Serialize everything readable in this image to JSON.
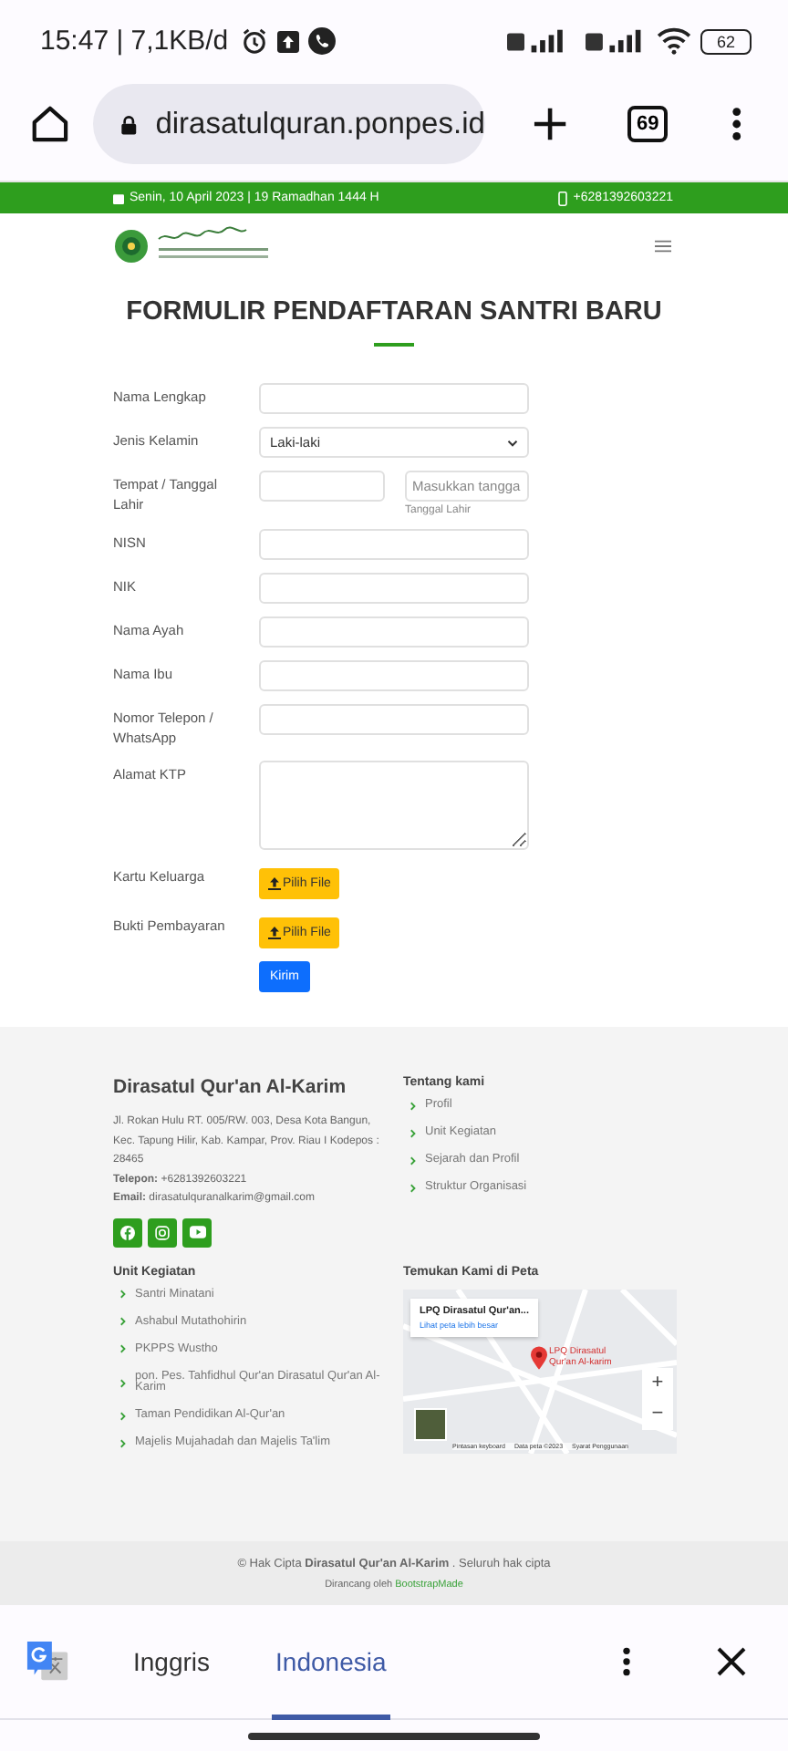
{
  "status_bar": {
    "time": "15:47 | 7,1KB/d",
    "battery": "62"
  },
  "browser": {
    "url": "dirasatulquran.ponpes.id",
    "tab_count": "69"
  },
  "top_bar": {
    "date": "Senin, 10 April 2023 | 19 Ramadhan 1444 H",
    "phone": "+6281392603221"
  },
  "form": {
    "title": "FORMULIR PENDAFTARAN SANTRI BARU",
    "fields": [
      {
        "kind": "text",
        "label": "Nama Lengkap"
      },
      {
        "kind": "select",
        "label": "Jenis Kelamin",
        "value": "Laki-laki"
      },
      {
        "kind": "date-pair",
        "label": "Tempat / Tanggal Lahir",
        "placeholder": "Masukkan tangga",
        "hint": "Tanggal Lahir"
      },
      {
        "kind": "text",
        "label": "NISN"
      },
      {
        "kind": "text",
        "label": "NIK"
      },
      {
        "kind": "text",
        "label": "Nama Ayah"
      },
      {
        "kind": "text",
        "label": "Nama Ibu"
      },
      {
        "kind": "text",
        "label": "Nomor Telepon / WhatsApp"
      },
      {
        "kind": "textarea",
        "label": "Alamat KTP"
      },
      {
        "kind": "file",
        "label": "Kartu Keluarga",
        "button": "Pilih File"
      },
      {
        "kind": "file",
        "label": "Bukti Pembayaran",
        "button": "Pilih File"
      }
    ],
    "submit": "Kirim"
  },
  "footer": {
    "name": "Dirasatul Qur'an Al-Karim",
    "address": "Jl. Rokan Hulu RT. 005/RW. 003, Desa Kota Bangun, Kec. Tapung Hilir, Kab. Kampar, Prov. Riau I Kodepos : 28465",
    "phone": "**Telepon:** +6281392603221",
    "email": "**Email:** dirasatulquranalkarim@gmail.com",
    "social": [
      {
        "kind": "facebook"
      },
      {
        "kind": "instagram"
      },
      {
        "kind": "youtube"
      }
    ],
    "about": {
      "title": "Tentang kami",
      "links": [
        "Profil",
        "Unit Kegiatan",
        "Sejarah dan Profil",
        "Struktur Organisasi"
      ]
    },
    "units": {
      "title": "Unit Kegiatan",
      "links": [
        "Santri Minatani",
        "Ashabul Mutathohirin",
        "PKPPS Wustho",
        "pon. Pes. Tahfidhul Qur'an Dirasatul Qur'an Al-Karim",
        "Taman Pendidikan Al-Qur'an",
        "Majelis Mujahadah dan Majelis Ta'lim"
      ]
    },
    "map": {
      "title": "Temukan Kami di Peta",
      "card_title": "LPQ Dirasatul Qur'an...",
      "card_link": "Lihat peta lebih besar",
      "marker_label": "LPQ Dirasatul Qur'an Al-karim",
      "zoom_in": "+",
      "zoom_out": "−",
      "attribution": [
        "Pintasan keyboard",
        "Data peta ©2023",
        "Syarat Penggunaan"
      ]
    }
  },
  "copyright": {
    "text": "© Hak Cipta **Dirasatul Qur'an Al-Karim** . Seluruh hak cipta",
    "credit": "Dirancang oleh",
    "credit_link": "BootstrapMade"
  },
  "translate_bar": {
    "languages": [
      {
        "label": "Inggris",
        "selected": false
      },
      {
        "label": "Indonesia",
        "selected": true
      }
    ]
  }
}
